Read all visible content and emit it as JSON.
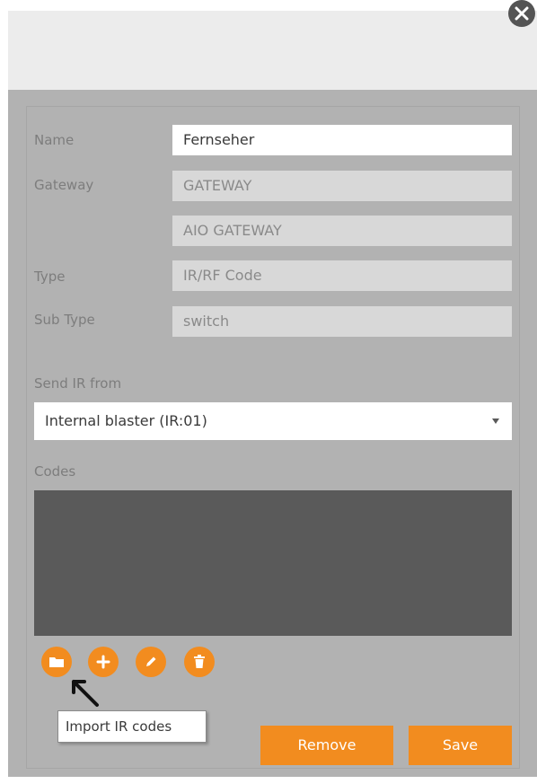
{
  "form": {
    "name_label": "Name",
    "name_value": "Fernseher",
    "gateway_label": "Gateway",
    "gateway_value": "GATEWAY",
    "gateway_model_value": "AIO GATEWAY",
    "type_label": "Type",
    "type_value": "IR/RF Code",
    "subtype_label": "Sub Type",
    "subtype_value": "switch",
    "send_ir_label": "Send IR from",
    "send_ir_value": "Internal blaster (IR:01)",
    "codes_label": "Codes"
  },
  "toolbar": {
    "icons": [
      "folder-icon",
      "plus-icon",
      "pencil-icon",
      "trash-icon"
    ],
    "tooltip": "Import IR codes"
  },
  "actions": {
    "remove_label": "Remove",
    "save_label": "Save"
  },
  "colors": {
    "accent": "#f28c1f",
    "panel": "#b2b2b2",
    "codes_bg": "#5a5a5a"
  }
}
